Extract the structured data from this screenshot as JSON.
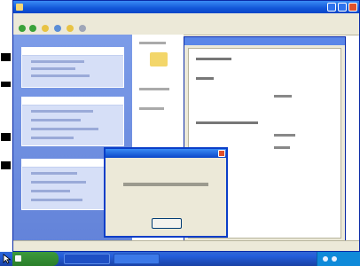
{
  "colors": {
    "desktop": "#3a6ea5",
    "titlebar": "#1256d8",
    "task_pane": "#6383d9",
    "face": "#ece9d8",
    "start_button": "#2a7f2a",
    "taskbar": "#245edb",
    "tray": "#0f8ad9"
  },
  "icons": {
    "desktop": [
      "desktop-shortcut-icon",
      "desktop-shortcut-icon",
      "desktop-shortcut-icon",
      "desktop-shortcut-icon"
    ],
    "window": "folder-icon",
    "start": "windows-flag-icon"
  },
  "window": {
    "title": ""
  },
  "dialog": {
    "title": "",
    "message": "",
    "button": ""
  },
  "taskbar": {
    "start_label": "",
    "clock": ""
  }
}
